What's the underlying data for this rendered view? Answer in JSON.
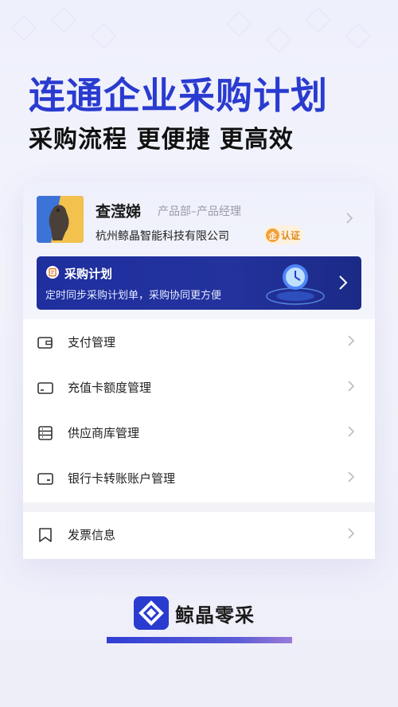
{
  "headline": "连通企业采购计划",
  "subline": "采购流程 更便捷 更高效",
  "profile": {
    "name": "查滢娣",
    "role": "产品部–产品经理",
    "company": "杭州鲸晶智能科技有限公司",
    "badge_icon_text": "企",
    "badge_text": "认证"
  },
  "plan": {
    "title": "采购计划",
    "description": "定时同步采购计划单，采购协同更方便"
  },
  "menu": {
    "items": [
      {
        "label": "支付管理",
        "icon": "wallet-icon"
      },
      {
        "label": "充值卡额度管理",
        "icon": "card-icon"
      },
      {
        "label": "供应商库管理",
        "icon": "list-icon"
      },
      {
        "label": "银行卡转账账户管理",
        "icon": "bank-card-icon"
      }
    ],
    "invoice": {
      "label": "发票信息",
      "icon": "bookmark-icon"
    }
  },
  "brand": {
    "name": "鲸晶零采"
  },
  "colors": {
    "accent": "#2a3bd0",
    "plan_bg": "#1f2f9e",
    "badge": "#f1a23a"
  }
}
